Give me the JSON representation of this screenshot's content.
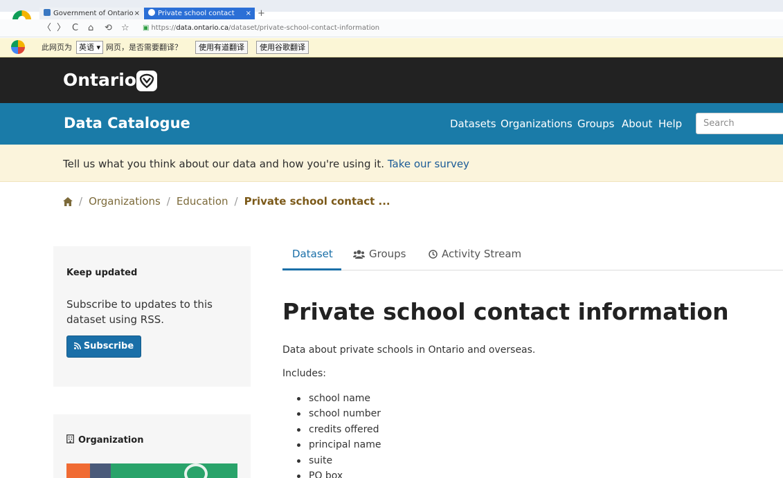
{
  "browser": {
    "tabs": [
      {
        "label": "Government of Ontario",
        "close": "×"
      },
      {
        "label": "Private school contact",
        "close": "×"
      }
    ],
    "new_tab": "+",
    "nav": {
      "back": "〈",
      "forward": "〉",
      "reload": "C",
      "home": "⌂",
      "history": "⟲",
      "bookmark": "☆"
    },
    "url": {
      "scheme": "https://",
      "host": "data.ontario.ca",
      "path": "/dataset/private-school-contact-information"
    },
    "translate_bar": {
      "prefix": "此网页为",
      "language": "英语 ▾",
      "suffix": "网页，是否需要翻译？",
      "youdao_button": "使用有道翻译",
      "google_button": "使用谷歌翻译"
    }
  },
  "site": {
    "brand": "Ontario",
    "catalogue_title": "Data Catalogue",
    "nav": [
      "Datasets",
      "Organizations",
      "Groups",
      "About",
      "Help"
    ],
    "search_placeholder": "Search",
    "survey_text": "Tell us what you think about our data and how you're using it. ",
    "survey_link": "Take our survey"
  },
  "breadcrumb": {
    "items": [
      "Organizations",
      "Education"
    ],
    "current": "Private school contact ...",
    "separator": "/"
  },
  "sidebar": {
    "keep_updated": {
      "heading": "Keep updated",
      "body": "Subscribe to updates to this dataset using RSS.",
      "button": "Subscribe"
    },
    "organization": {
      "heading": "Organization"
    }
  },
  "main": {
    "tabs": [
      "Dataset",
      "Groups",
      "Activity Stream"
    ],
    "title": "Private school contact information",
    "description": "Data about private schools in Ontario and overseas.",
    "includes_label": "Includes:",
    "includes": [
      "school name",
      "school number",
      "credits offered",
      "principal name",
      "suite",
      "PO box"
    ]
  },
  "colors": {
    "header_dark": "#222222",
    "catalogue_blue": "#1a7ba8",
    "survey_banner": "#fbf4dc",
    "accent": "#1a6fa8",
    "breadcrumb_current": "#7c5a1a"
  }
}
